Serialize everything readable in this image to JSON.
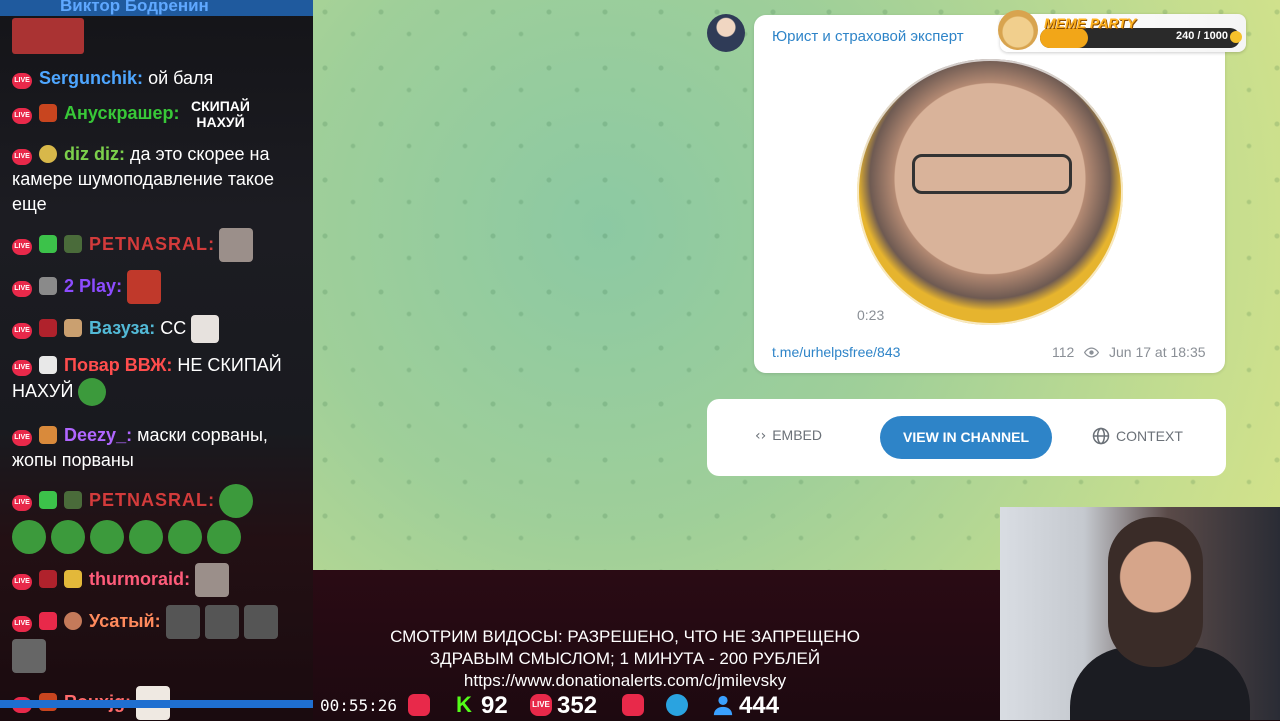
{
  "chat": {
    "top_user": "Виктор Бодренин",
    "messages": [
      {
        "user": "Sergunchik",
        "color": "#4ea6ff",
        "text": "ой баля"
      },
      {
        "user": "Анускрашер",
        "color": "#38c838",
        "text": "СКИПАЙ НАХУЙ"
      },
      {
        "user": "diz diz",
        "color": "#7cd04b",
        "text": "да это скорее на камере шумоподавление такое еще"
      },
      {
        "user": "PETNASRAL",
        "color": "#d33b3b",
        "text": ""
      },
      {
        "user": "2 Play",
        "color": "#8d4cff",
        "text": ""
      },
      {
        "user": "Вазуза",
        "color": "#52b9d6",
        "text": "СС"
      },
      {
        "user": "Повар ВВЖ",
        "color": "#ff4d4d",
        "text": "НЕ СКИПАЙ НАХУЙ"
      },
      {
        "user": "Deezy_",
        "color": "#b066ff",
        "text": "маски сорваны, жопы порваны"
      },
      {
        "user": "PETNASRAL",
        "color": "#d33b3b",
        "text": ""
      },
      {
        "user": "thurmoraid",
        "color": "#ff5c7a",
        "text": ""
      },
      {
        "user": "Усатый",
        "color": "#ff8a5c",
        "text": ""
      },
      {
        "user": "Rouxjg",
        "color": "#ff6b6b",
        "text": ""
      }
    ]
  },
  "telegram": {
    "channel_name": "Юрист и страховой эксперт",
    "video_duration": "0:23",
    "post_link": "t.me/urhelpsfree/843",
    "views": "112",
    "date": "Jun 17 at 18:35",
    "embed_label": "EMBED",
    "view_label": "VIEW IN CHANNEL",
    "context_label": "CONTEXT",
    "accent": "#2e84c8"
  },
  "meme_party": {
    "title": "MEME PARTY",
    "count": "240 / 1000",
    "progress": 0.24
  },
  "overlay": {
    "rules_line1": "СМОТРИМ ВИДОСЫ: РАЗРЕШЕНО, ЧТО НЕ ЗАПРЕЩЕНО",
    "rules_line2": "ЗДРАВЫМ СМЫСЛОМ; 1 МИНУТА - 200 РУБЛЕЙ",
    "rules_url": "https://www.donationalerts.com/c/jmilevsky",
    "uptime": "00:55:26",
    "kick_count": "92",
    "vk_count": "352",
    "viewers": "444"
  }
}
